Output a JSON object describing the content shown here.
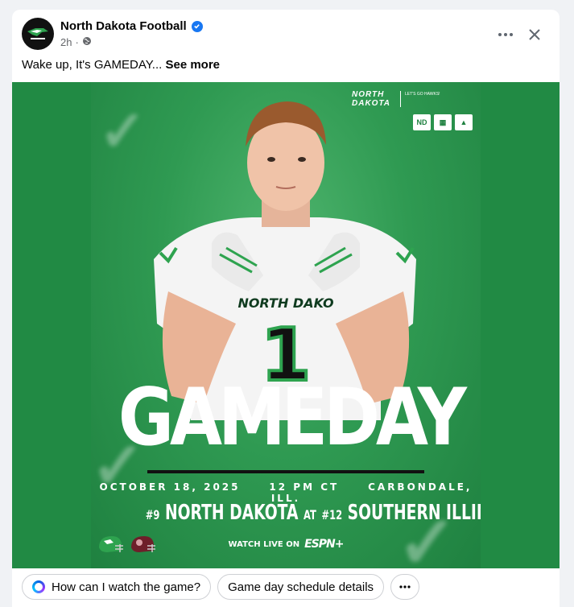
{
  "post": {
    "page_name": "North Dakota Football",
    "time": "2h",
    "separator": "·",
    "caption": "Wake up, It's GAMEDAY...",
    "see_more": "See more"
  },
  "poster": {
    "headline": "GAMEDAY",
    "brand_top": "NORTH",
    "brand_bottom": "DAKOTA",
    "brand_tag": "LET'S GO HAWKS!",
    "jersey_text": "NORTH DAKO",
    "jersey_number": "1",
    "date": "OCTOBER 18, 2025",
    "time": "12 PM CT",
    "location": "CARBONDALE, ILL.",
    "home_rank": "#9",
    "home_team": "NORTH DAKOTA",
    "at": "AT",
    "away_rank": "#12",
    "away_team": "SOUTHERN ILLINOIS",
    "watch_label": "WATCH LIVE ON",
    "network": "ESPN+"
  },
  "suggestions": [
    {
      "label": "How can I watch the game?"
    },
    {
      "label": "Game day schedule details"
    }
  ],
  "icons": {
    "more": "more-options-icon",
    "close": "close-icon",
    "globe": "globe-icon",
    "verified": "verified-badge-icon"
  },
  "colors": {
    "brand_green": "#218a44",
    "verified_blue": "#1877f2"
  }
}
